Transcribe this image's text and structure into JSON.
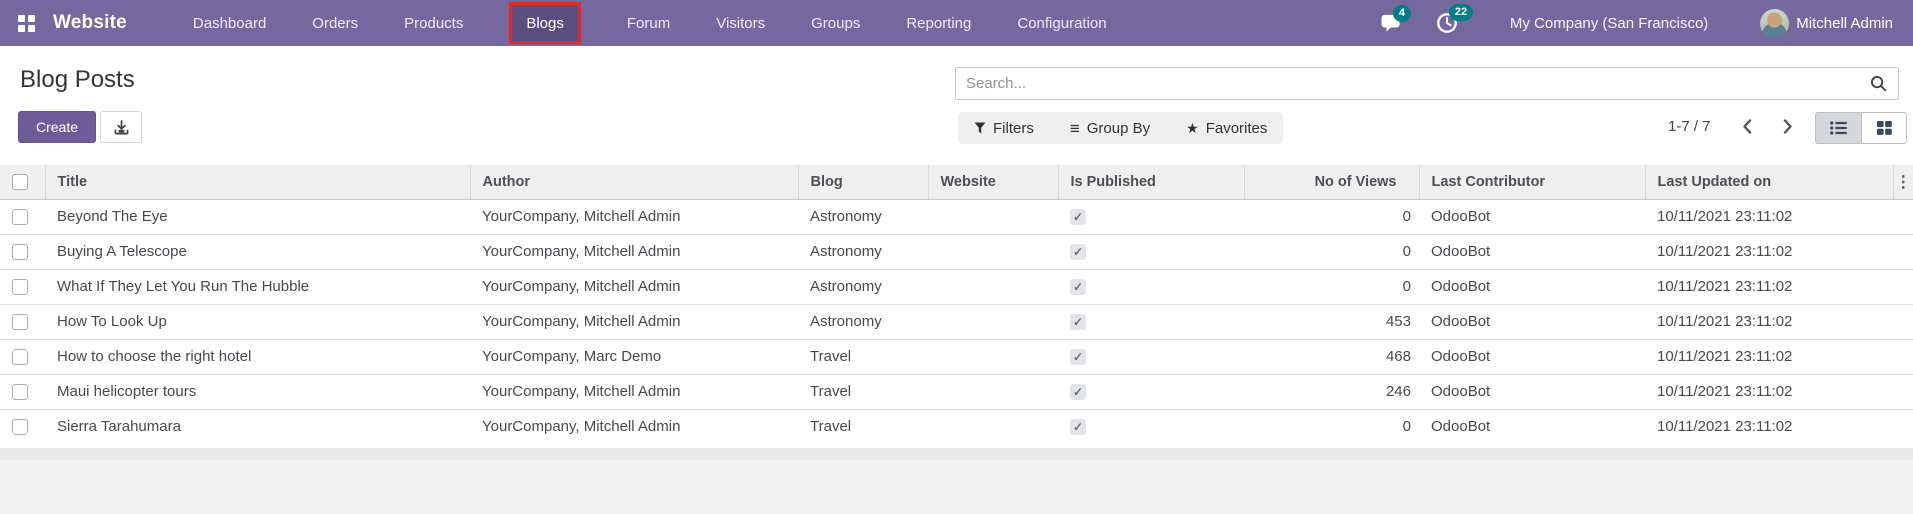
{
  "colors": {
    "topbar": "#74689e",
    "badge": "#017e84",
    "annotation": "#e8262a",
    "primary_button": "#6e5c99",
    "switcher_active_bg": "#d4d8dd"
  },
  "topbar": {
    "brand": "Website",
    "menu": [
      "Dashboard",
      "Orders",
      "Products",
      "Blogs",
      "Forum",
      "Visitors",
      "Groups",
      "Reporting",
      "Configuration"
    ],
    "active_item": "Blogs",
    "messages_badge": "4",
    "activities_badge": "22",
    "company": "My Company (San Francisco)",
    "user": "Mitchell Admin"
  },
  "control_panel": {
    "title": "Blog Posts",
    "create_label": "Create",
    "search_placeholder": "Search...",
    "filters_label": "Filters",
    "group_by_label": "Group By",
    "favorites_label": "Favorites",
    "pager": "1-7 / 7"
  },
  "table": {
    "headers": {
      "title": "Title",
      "author": "Author",
      "blog": "Blog",
      "website": "Website",
      "is_published": "Is Published",
      "views": "No of Views",
      "last_contributor": "Last Contributor",
      "last_updated": "Last Updated on"
    },
    "rows": [
      {
        "title": "Beyond The Eye",
        "author": "YourCompany, Mitchell Admin",
        "blog": "Astronomy",
        "website": "",
        "is_published": true,
        "views": "0",
        "last_contributor": "OdooBot",
        "last_updated": "10/11/2021 23:11:02"
      },
      {
        "title": "Buying A Telescope",
        "author": "YourCompany, Mitchell Admin",
        "blog": "Astronomy",
        "website": "",
        "is_published": true,
        "views": "0",
        "last_contributor": "OdooBot",
        "last_updated": "10/11/2021 23:11:02"
      },
      {
        "title": "What If They Let You Run The Hubble",
        "author": "YourCompany, Mitchell Admin",
        "blog": "Astronomy",
        "website": "",
        "is_published": true,
        "views": "0",
        "last_contributor": "OdooBot",
        "last_updated": "10/11/2021 23:11:02"
      },
      {
        "title": "How To Look Up",
        "author": "YourCompany, Mitchell Admin",
        "blog": "Astronomy",
        "website": "",
        "is_published": true,
        "views": "453",
        "last_contributor": "OdooBot",
        "last_updated": "10/11/2021 23:11:02"
      },
      {
        "title": "How to choose the right hotel",
        "author": "YourCompany, Marc Demo",
        "blog": "Travel",
        "website": "",
        "is_published": true,
        "views": "468",
        "last_contributor": "OdooBot",
        "last_updated": "10/11/2021 23:11:02"
      },
      {
        "title": "Maui helicopter tours",
        "author": "YourCompany, Mitchell Admin",
        "blog": "Travel",
        "website": "",
        "is_published": true,
        "views": "246",
        "last_contributor": "OdooBot",
        "last_updated": "10/11/2021 23:11:02"
      },
      {
        "title": "Sierra Tarahumara",
        "author": "YourCompany, Mitchell Admin",
        "blog": "Travel",
        "website": "",
        "is_published": true,
        "views": "0",
        "last_contributor": "OdooBot",
        "last_updated": "10/11/2021 23:11:02"
      }
    ]
  }
}
